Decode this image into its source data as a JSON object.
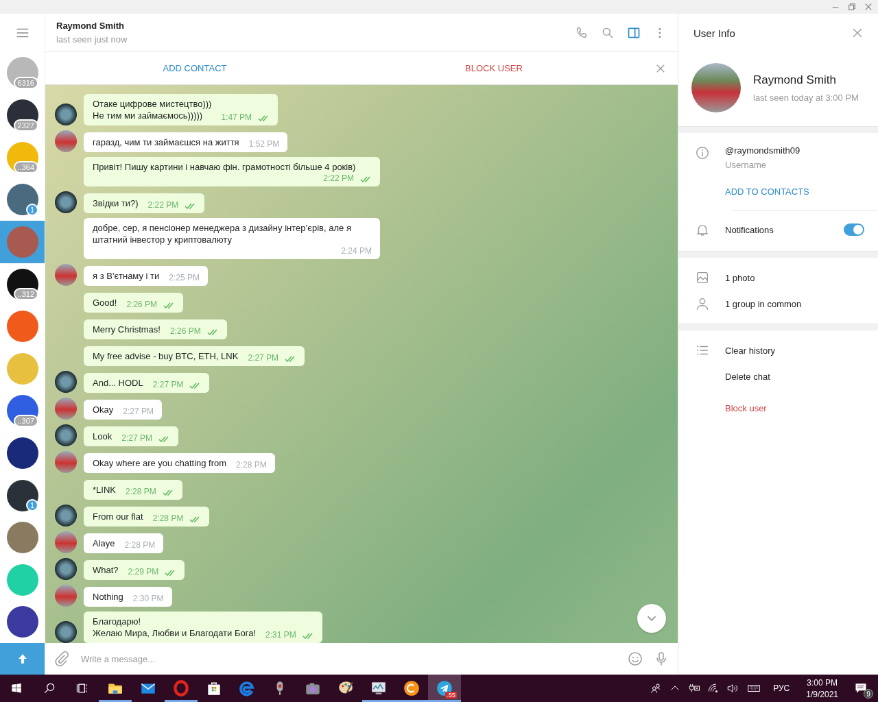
{
  "sidebar": {
    "items": [
      {
        "badge": "6316",
        "badge_muted": true,
        "selected": false,
        "color": "#b8b8b8"
      },
      {
        "badge": "2327",
        "badge_muted": true,
        "selected": false,
        "color": "#2a2f3a"
      },
      {
        "badge": "..364",
        "badge_muted": true,
        "selected": false,
        "color": "#f0b90b"
      },
      {
        "badge": "1",
        "badge_muted": false,
        "selected": false,
        "color": "#4a6a80"
      },
      {
        "selected": true,
        "color": "#a85a50"
      },
      {
        "badge": "..312",
        "badge_muted": true,
        "selected": false,
        "color": "#111111"
      },
      {
        "selected": false,
        "color": "#f05a1a"
      },
      {
        "selected": false,
        "color": "#e8c040"
      },
      {
        "badge": "..307",
        "badge_muted": true,
        "selected": false,
        "color": "#2f5fe0"
      },
      {
        "selected": false,
        "color": "#1a2a7a"
      },
      {
        "badge": "1",
        "badge_muted": false,
        "selected": false,
        "color": "#2b3138"
      },
      {
        "selected": false,
        "color": "#8a7a60"
      },
      {
        "selected": false,
        "color": "#1fd1a5"
      },
      {
        "selected": false,
        "color": "#3a3aa0"
      }
    ]
  },
  "chat": {
    "name": "Raymond Smith",
    "status": "last seen just now",
    "actions": [
      {
        "label": "ADD CONTACT",
        "kind": "primary"
      },
      {
        "label": "BLOCK USER",
        "kind": "danger"
      }
    ],
    "messages": [
      {
        "outgoing": true,
        "text": "Отаке цифрове мистецтво)))\nНе тим ми займаємось)))))",
        "time": "1:47 PM",
        "read": true,
        "show_avatar": true
      },
      {
        "outgoing": false,
        "text": "гаразд, чим ти займаєшся на життя",
        "time": "1:52 PM",
        "show_avatar": true
      },
      {
        "outgoing": true,
        "text": "Привіт! Пишу картини і навчаю фін. грамотності більше 4 років)",
        "time": "2:22 PM",
        "read": true,
        "show_avatar": false
      },
      {
        "outgoing": true,
        "text": "Звідки ти?)",
        "time": "2:22 PM",
        "read": true,
        "show_avatar": true
      },
      {
        "outgoing": false,
        "text": "добре, сер, я пенсіонер менеджера з дизайну інтер’єрів, але я штатний інвестор у криптовалюту",
        "time": "2:24 PM",
        "show_avatar": false
      },
      {
        "outgoing": false,
        "text": "я з В'єтнаму і ти",
        "time": "2:25 PM",
        "show_avatar": true
      },
      {
        "outgoing": true,
        "text": "Good!",
        "time": "2:26 PM",
        "read": true,
        "show_avatar": false
      },
      {
        "outgoing": true,
        "text": "Merry Christmas!",
        "time": "2:26 PM",
        "read": true,
        "show_avatar": false
      },
      {
        "outgoing": true,
        "text": "My free advise - buy BTC, ETH, LNK",
        "time": "2:27 PM",
        "read": true,
        "show_avatar": false
      },
      {
        "outgoing": true,
        "text": "And... HODL",
        "time": "2:27 PM",
        "read": true,
        "show_avatar": true
      },
      {
        "outgoing": false,
        "text": "Okay",
        "time": "2:27 PM",
        "show_avatar": true
      },
      {
        "outgoing": true,
        "text": "Look",
        "time": "2:27 PM",
        "read": true,
        "show_avatar": true
      },
      {
        "outgoing": false,
        "text": "Okay where are you chatting from",
        "time": "2:28 PM",
        "show_avatar": true
      },
      {
        "outgoing": true,
        "text": "*LINK",
        "time": "2:28 PM",
        "read": true,
        "show_avatar": false
      },
      {
        "outgoing": true,
        "text": "From our flat",
        "time": "2:28 PM",
        "read": true,
        "show_avatar": true
      },
      {
        "outgoing": false,
        "text": "Alaye",
        "time": "2:28 PM",
        "show_avatar": true
      },
      {
        "outgoing": true,
        "text": "What?",
        "time": "2:29 PM",
        "read": true,
        "show_avatar": true
      },
      {
        "outgoing": false,
        "text": "Nothing",
        "time": "2:30 PM",
        "show_avatar": true
      },
      {
        "outgoing": true,
        "text": "Благодарю!\nЖелаю Мира, Любви и Благодати Бога!",
        "time": "2:31 PM",
        "read": true,
        "show_avatar": true
      }
    ],
    "composer": {
      "placeholder": "Write a message..."
    }
  },
  "user_info": {
    "title": "User Info",
    "name": "Raymond Smith",
    "status": "last seen today at 3:00 PM",
    "username": "@raymondsmith09",
    "username_label": "Username",
    "add_to_contacts": "ADD TO CONTACTS",
    "notifications": {
      "label": "Notifications",
      "on": true
    },
    "media": [
      {
        "label": "1 photo",
        "kind": "photo"
      },
      {
        "label": "1 group in common",
        "kind": "group"
      }
    ],
    "actions": [
      {
        "label": "Clear history",
        "kind": "normal"
      },
      {
        "label": "Delete chat",
        "kind": "normal"
      },
      {
        "label": "Block user",
        "kind": "danger"
      }
    ]
  },
  "taskbar": {
    "apps": [
      {
        "kind": "folder",
        "running": true,
        "active": false
      },
      {
        "kind": "mail",
        "running": false,
        "active": false
      },
      {
        "kind": "ring",
        "running": true,
        "active": false
      },
      {
        "kind": "bag",
        "running": false,
        "active": false
      },
      {
        "kind": "browser",
        "running": false,
        "active": false
      },
      {
        "kind": "mic",
        "running": false,
        "active": false
      },
      {
        "kind": "camera",
        "running": false,
        "active": false
      },
      {
        "kind": "palette",
        "running": false,
        "active": false
      },
      {
        "kind": "monitor",
        "running": true,
        "active": false
      },
      {
        "kind": "coin",
        "running": true,
        "active": false
      },
      {
        "kind": "plane",
        "running": true,
        "active": true,
        "badge": ".55"
      }
    ],
    "language": "РУС",
    "time": "3:00 PM",
    "date": "1/9/2021",
    "notification_count": "9"
  }
}
